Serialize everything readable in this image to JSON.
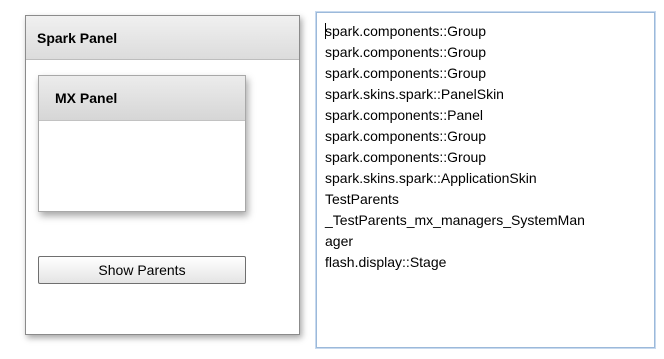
{
  "spark_panel": {
    "title": "Spark Panel"
  },
  "mx_panel": {
    "title": "MX Panel"
  },
  "show_parents_button": {
    "label": "Show Parents"
  },
  "output_textarea": {
    "lines": [
      "spark.components::Group",
      "spark.components::Group",
      "spark.components::Group",
      "spark.skins.spark::PanelSkin",
      "spark.components::Panel",
      "spark.components::Group",
      "spark.components::Group",
      "spark.skins.spark::ApplicationSkin",
      "TestParents",
      "_TestParents_mx_managers_SystemMan",
      "ager",
      "flash.display::Stage"
    ]
  }
}
